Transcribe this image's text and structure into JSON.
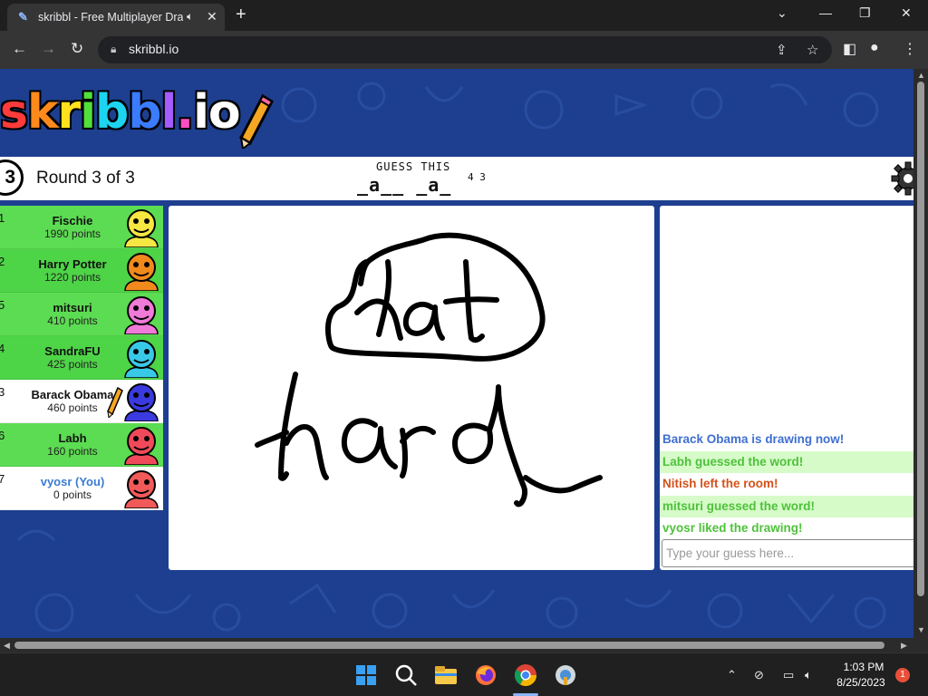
{
  "browser": {
    "tab_title": "skribbl - Free Multiplayer Drawing & Guessing Game",
    "url": "skribbl.io"
  },
  "game": {
    "logo_text": "skribbl.io",
    "round_number": "3",
    "round_text": "Round 3 of 3",
    "guess_label": "GUESS THIS",
    "hint": "_a__ _a_",
    "hint_lengths": "4 3"
  },
  "players": [
    {
      "rank": "1",
      "name": "Fischie",
      "points": "1990 points",
      "bg": "#5cdc52",
      "avatar_color": "#f5e642",
      "drawing": false,
      "you": false
    },
    {
      "rank": "2",
      "name": "Harry Potter",
      "points": "1220 points",
      "bg": "#4ed447",
      "avatar_color": "#f08a1c",
      "drawing": false,
      "you": false
    },
    {
      "rank": "5",
      "name": "mitsuri",
      "points": "410 points",
      "bg": "#5cdc52",
      "avatar_color": "#f07ad8",
      "drawing": false,
      "you": false
    },
    {
      "rank": "4",
      "name": "SandraFU",
      "points": "425 points",
      "bg": "#4ed447",
      "avatar_color": "#38c8e8",
      "drawing": false,
      "you": false
    },
    {
      "rank": "3",
      "name": "Barack Obama",
      "points": "460 points",
      "bg": "#ffffff",
      "avatar_color": "#3a3ae0",
      "drawing": true,
      "you": false
    },
    {
      "rank": "6",
      "name": "Labh",
      "points": "160 points",
      "bg": "#5cdc52",
      "avatar_color": "#f04a5a",
      "drawing": false,
      "you": false
    },
    {
      "rank": "7",
      "name": "vyosr (You)",
      "points": "0 points",
      "bg": "#ffffff",
      "avatar_color": "#f25a5a",
      "drawing": false,
      "you": true
    }
  ],
  "chat": {
    "messages": [
      {
        "text": "Barack Obama is drawing now!",
        "color": "#3f6fd1",
        "bg": "#ffffff"
      },
      {
        "text": "Labh guessed the word!",
        "color": "#4ec23a",
        "bg": "#d6fbc9"
      },
      {
        "text": "Nitish left the room!",
        "color": "#d4521c",
        "bg": "#ffffff"
      },
      {
        "text": "mitsuri guessed the word!",
        "color": "#4ec23a",
        "bg": "#d6fbc9"
      },
      {
        "text": "vyosr liked the drawing!",
        "color": "#4ec23a",
        "bg": "#ffffff"
      }
    ],
    "input_placeholder": "Type your guess here..."
  },
  "taskbar": {
    "time": "1:03 PM",
    "date": "8/25/2023",
    "notification_count": "1"
  },
  "colors": {
    "page_bg": "#1e3f8f",
    "logo_letters": [
      "#ff3b3b",
      "#ff8a1c",
      "#ffe21c",
      "#52e03a",
      "#1cd4f0",
      "#3a7bff",
      "#a45cff",
      "#ff4ec4",
      "#ffffff",
      "#ffffff"
    ]
  },
  "icons": [
    "search-icon",
    "lock-icon",
    "share-icon",
    "star-icon",
    "sidepanel-icon",
    "profile-icon",
    "menu-icon",
    "gear-icon",
    "pencil-icon",
    "alarm-clock-icon"
  ]
}
